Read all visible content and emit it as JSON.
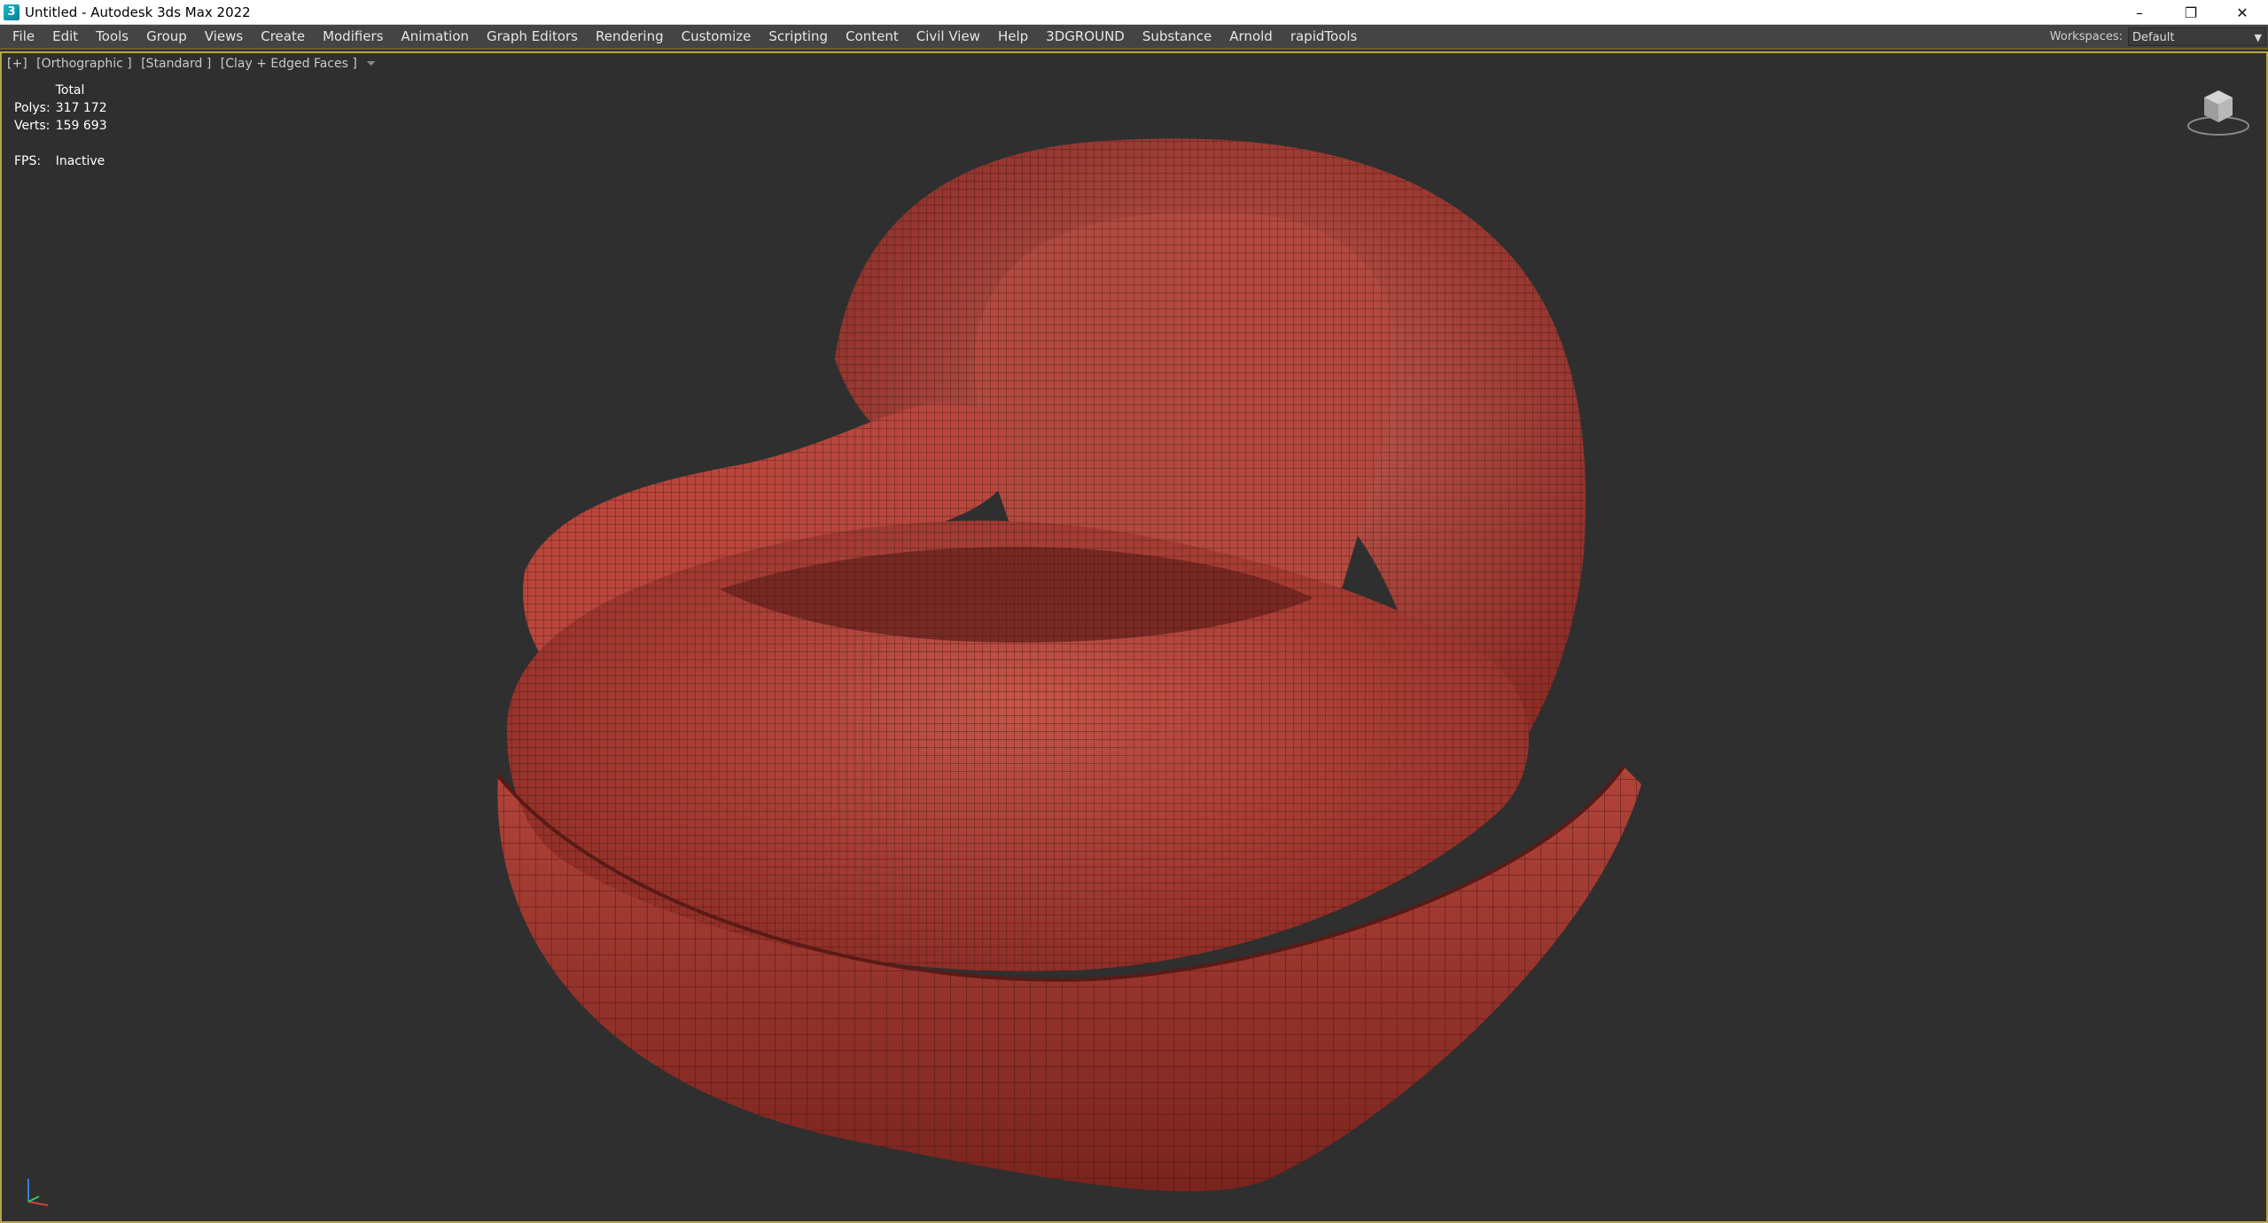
{
  "window": {
    "title": "Untitled - Autodesk 3ds Max 2022",
    "icon": "3ds-max-app-icon",
    "controls": {
      "minimize": "–",
      "restore": "❐",
      "close": "✕"
    }
  },
  "menu": {
    "items": [
      "File",
      "Edit",
      "Tools",
      "Group",
      "Views",
      "Create",
      "Modifiers",
      "Animation",
      "Graph Editors",
      "Rendering",
      "Customize",
      "Scripting",
      "Content",
      "Civil View",
      "Help",
      "3DGROUND",
      "Substance",
      "Arnold",
      "rapidTools"
    ],
    "workspaces_label": "Workspaces:",
    "workspace_value": "Default"
  },
  "viewport": {
    "label_plus": "[+]",
    "label_view": "[Orthographic ]",
    "label_shading": "[Standard ]",
    "label_style": "[Clay + Edged Faces ]",
    "stats": {
      "header": "Total",
      "polys_label": "Polys:",
      "polys_value": "317 172",
      "verts_label": "Verts:",
      "verts_value": "159 693",
      "fps_label": "FPS:",
      "fps_value": "Inactive"
    },
    "model": "tufted-lounge-chair-wireframe",
    "colors": {
      "model": "#b8443a",
      "wire": "#3a1410",
      "background": "#2f2f2f",
      "active_border": "#b7a44a"
    }
  }
}
